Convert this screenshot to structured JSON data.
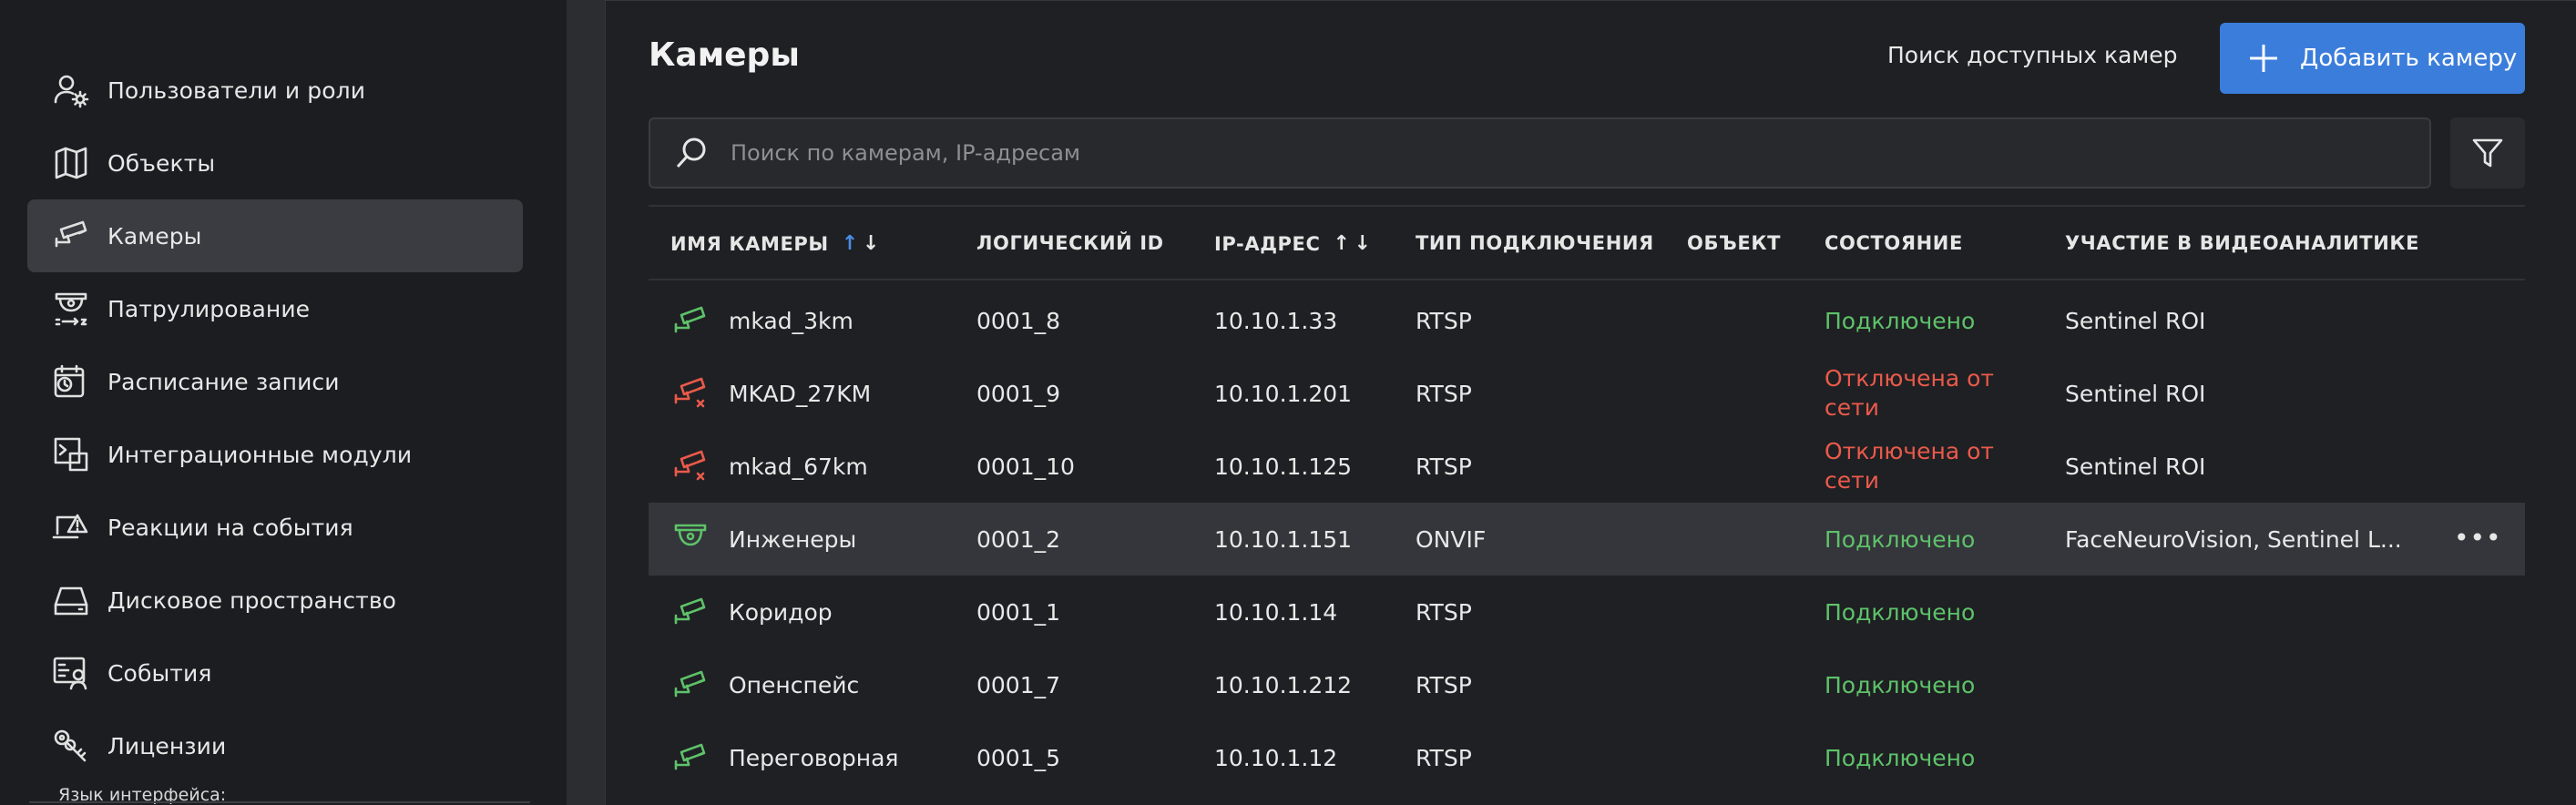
{
  "sidebar": {
    "items": [
      {
        "label": "Пользователи и роли",
        "icon": "users-roles-icon"
      },
      {
        "label": "Объекты",
        "icon": "objects-map-icon"
      },
      {
        "label": "Камеры",
        "icon": "camera-icon",
        "active": true
      },
      {
        "label": "Патрулирование",
        "icon": "patrol-icon"
      },
      {
        "label": "Расписание записи",
        "icon": "schedule-icon"
      },
      {
        "label": "Интеграционные модули",
        "icon": "integration-icon"
      },
      {
        "label": "Реакции на события",
        "icon": "event-reaction-icon"
      },
      {
        "label": "Дисковое пространство",
        "icon": "disk-icon"
      },
      {
        "label": "События",
        "icon": "events-icon"
      },
      {
        "label": "Лицензии",
        "icon": "license-key-icon"
      }
    ],
    "language_label": "Язык интерфейса:"
  },
  "header": {
    "title": "Камеры",
    "search_cameras_label": "Поиск доступных камер",
    "add_camera_label": "Добавить камеру"
  },
  "search": {
    "placeholder": "Поиск по камерам, IP-адресам",
    "value": ""
  },
  "table": {
    "columns": [
      "ИМЯ КАМЕРЫ",
      "ЛОГИЧЕСКИЙ ID",
      "IP-АДРЕС",
      "ТИП ПОДКЛЮЧЕНИЯ",
      "ОБЪЕКТ",
      "СОСТОЯНИЕ",
      "УЧАСТИЕ В ВИДЕОАНАЛИТИКЕ"
    ],
    "rows": [
      {
        "name": "mkad_3km",
        "id": "0001_8",
        "ip": "10.10.1.33",
        "type": "RTSP",
        "object": "",
        "status": "Подключено",
        "online": true,
        "analytics": "Sentinel ROI",
        "icon": "camera-icon"
      },
      {
        "name": "MKAD_27KM",
        "id": "0001_9",
        "ip": "10.10.1.201",
        "type": "RTSP",
        "object": "",
        "status": "Отключена от сети",
        "online": false,
        "analytics": "Sentinel ROI",
        "icon": "camera-offline-icon"
      },
      {
        "name": "mkad_67km",
        "id": "0001_10",
        "ip": "10.10.1.125",
        "type": "RTSP",
        "object": "",
        "status": "Отключена от сети",
        "online": false,
        "analytics": "Sentinel ROI",
        "icon": "camera-offline-icon"
      },
      {
        "name": "Инженеры",
        "id": "0001_2",
        "ip": "10.10.1.151",
        "type": "ONVIF",
        "object": "",
        "status": "Подключено",
        "online": true,
        "analytics": "FaceNeuroVision, Sentinel L...",
        "icon": "dome-camera-icon",
        "selected": true,
        "more": "•••"
      },
      {
        "name": "Коридор",
        "id": "0001_1",
        "ip": "10.10.1.14",
        "type": "RTSP",
        "object": "",
        "status": "Подключено",
        "online": true,
        "analytics": "",
        "icon": "camera-icon"
      },
      {
        "name": "Опенспейс",
        "id": "0001_7",
        "ip": "10.10.1.212",
        "type": "RTSP",
        "object": "",
        "status": "Подключено",
        "online": true,
        "analytics": "",
        "icon": "camera-icon"
      },
      {
        "name": "Переговорная",
        "id": "0001_5",
        "ip": "10.10.1.12",
        "type": "RTSP",
        "object": "",
        "status": "Подключено",
        "online": true,
        "analytics": "",
        "icon": "camera-icon"
      }
    ]
  },
  "colors": {
    "accent": "#3b7ddb",
    "status_online": "#5ec26a",
    "status_offline": "#ea5a4b",
    "sort_active": "#4a8de6"
  }
}
